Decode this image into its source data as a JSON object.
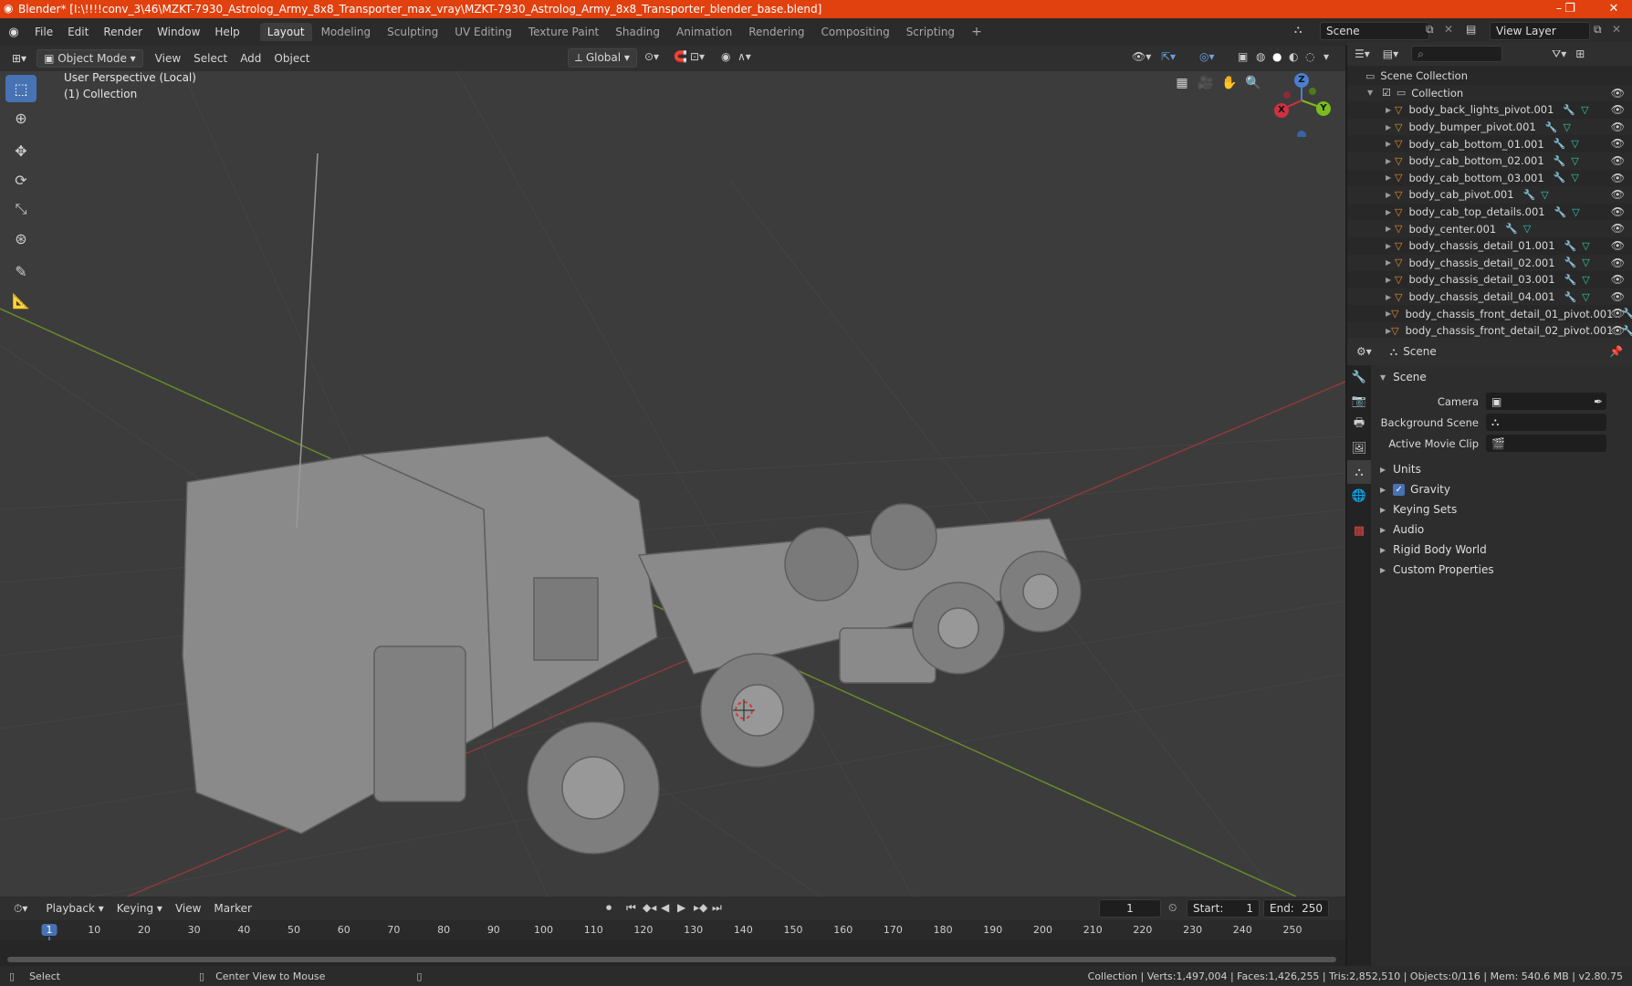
{
  "titlebar": {
    "title": "Blender* [I:\\!!!!conv_3\\46\\MZKT-7930_Astrolog_Army_8x8_Transporter_max_vray\\MZKT-7930_Astrolog_Army_8x8_Transporter_blender_base.blend]",
    "minimize": "–",
    "maximize": "❐",
    "close": "✕"
  },
  "menubar": {
    "items": [
      "File",
      "Edit",
      "Render",
      "Window",
      "Help"
    ],
    "workspaces": [
      "Layout",
      "Modeling",
      "Sculpting",
      "UV Editing",
      "Texture Paint",
      "Shading",
      "Animation",
      "Rendering",
      "Compositing",
      "Scripting"
    ],
    "active_workspace": "Layout",
    "add_tab": "+",
    "scene_name": "Scene",
    "view_layer": "View Layer"
  },
  "viewport_header": {
    "mode": "Object Mode",
    "menus": [
      "View",
      "Select",
      "Add",
      "Object"
    ],
    "orientation": "Global"
  },
  "viewport": {
    "perspective_label": "User Perspective (Local)",
    "collection_label": "(1) Collection",
    "gizmo_axes": [
      "X",
      "Y",
      "Z"
    ]
  },
  "outliner": {
    "root": "Scene Collection",
    "collection": "Collection",
    "objects": [
      "body_back_lights_pivot.001",
      "body_bumper_pivot.001",
      "body_cab_bottom_01.001",
      "body_cab_bottom_02.001",
      "body_cab_bottom_03.001",
      "body_cab_pivot.001",
      "body_cab_top_details.001",
      "body_center.001",
      "body_chassis_detail_01.001",
      "body_chassis_detail_02.001",
      "body_chassis_detail_03.001",
      "body_chassis_detail_04.001",
      "body_chassis_front_detail_01_pivot.001",
      "body_chassis_front_detail_02_pivot.001"
    ]
  },
  "properties": {
    "header": "Scene",
    "panel_title": "Scene",
    "fields": [
      {
        "label": "Camera",
        "value": ""
      },
      {
        "label": "Background Scene",
        "value": ""
      },
      {
        "label": "Active Movie Clip",
        "value": ""
      }
    ],
    "subpanels": [
      "Units",
      "Gravity",
      "Keying Sets",
      "Audio",
      "Rigid Body World",
      "Custom Properties"
    ],
    "gravity_checked": true
  },
  "timeline": {
    "menus": [
      "Playback",
      "Keying",
      "View",
      "Marker"
    ],
    "current_frame": "1",
    "start_label": "Start:",
    "start": "1",
    "end_label": "End:",
    "end": "250",
    "ticks": [
      "1",
      "10",
      "20",
      "30",
      "40",
      "50",
      "60",
      "70",
      "80",
      "90",
      "100",
      "110",
      "120",
      "130",
      "140",
      "150",
      "160",
      "170",
      "180",
      "190",
      "200",
      "210",
      "220",
      "230",
      "240",
      "250"
    ]
  },
  "statusbar": {
    "select": "Select",
    "center_view": "Center View to Mouse",
    "stats": "Collection | Verts:1,497,004 | Faces:1,426,255 | Tris:2,852,510 | Objects:0/116 | Mem: 540.6 MB | v2.80.75"
  },
  "colors": {
    "accent": "#4772b3",
    "titlebar": "#e1400f",
    "mesh_icon": "#e88a2e"
  }
}
